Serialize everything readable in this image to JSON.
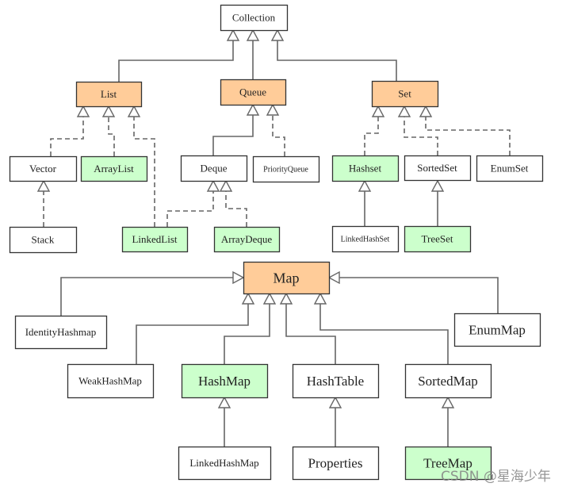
{
  "colors": {
    "interface": "#FFCC99",
    "implementation": "#CCFFCC",
    "plain": "#FFFFFF",
    "line": "#666666",
    "border": "#333333"
  },
  "nodes": {
    "collection": {
      "label": "Collection",
      "kind": "plain"
    },
    "list": {
      "label": "List",
      "kind": "interface"
    },
    "queue": {
      "label": "Queue",
      "kind": "interface"
    },
    "set": {
      "label": "Set",
      "kind": "interface"
    },
    "vector": {
      "label": "Vector",
      "kind": "plain"
    },
    "arraylist": {
      "label": "ArrayList",
      "kind": "implementation"
    },
    "deque": {
      "label": "Deque",
      "kind": "plain"
    },
    "priorityqueue": {
      "label": "PriorityQueue",
      "kind": "plain"
    },
    "hashset": {
      "label": "Hashset",
      "kind": "implementation"
    },
    "sortedset": {
      "label": "SortedSet",
      "kind": "plain"
    },
    "enumset": {
      "label": "EnumSet",
      "kind": "plain"
    },
    "stack": {
      "label": "Stack",
      "kind": "plain"
    },
    "linkedlist": {
      "label": "LinkedList",
      "kind": "implementation"
    },
    "arraydeque": {
      "label": "ArrayDeque",
      "kind": "implementation"
    },
    "linkedhashset": {
      "label": "LinkedHashSet",
      "kind": "plain"
    },
    "treeset": {
      "label": "TreeSet",
      "kind": "implementation"
    },
    "map": {
      "label": "Map",
      "kind": "interface"
    },
    "identityhashmap": {
      "label": "IdentityHashmap",
      "kind": "plain"
    },
    "enummap": {
      "label": "EnumMap",
      "kind": "plain"
    },
    "weakhashmap": {
      "label": "WeakHashMap",
      "kind": "plain"
    },
    "hashmap": {
      "label": "HashMap",
      "kind": "implementation"
    },
    "hashtable": {
      "label": "HashTable",
      "kind": "plain"
    },
    "sortedmap": {
      "label": "SortedMap",
      "kind": "plain"
    },
    "linkedhashmap": {
      "label": "LinkedHashMap",
      "kind": "plain"
    },
    "properties": {
      "label": "Properties",
      "kind": "plain"
    },
    "treemap": {
      "label": "TreeMap",
      "kind": "implementation"
    }
  },
  "edges": [
    {
      "from": "list",
      "to": "collection",
      "style": "solid"
    },
    {
      "from": "queue",
      "to": "collection",
      "style": "solid"
    },
    {
      "from": "set",
      "to": "collection",
      "style": "solid"
    },
    {
      "from": "vector",
      "to": "list",
      "style": "dashed"
    },
    {
      "from": "arraylist",
      "to": "list",
      "style": "dashed"
    },
    {
      "from": "linkedlist",
      "to": "list",
      "style": "dashed"
    },
    {
      "from": "stack",
      "to": "vector",
      "style": "dashed"
    },
    {
      "from": "deque",
      "to": "queue",
      "style": "solid"
    },
    {
      "from": "priorityqueue",
      "to": "queue",
      "style": "dashed"
    },
    {
      "from": "linkedlist",
      "to": "deque",
      "style": "dashed"
    },
    {
      "from": "arraydeque",
      "to": "deque",
      "style": "dashed"
    },
    {
      "from": "hashset",
      "to": "set",
      "style": "dashed"
    },
    {
      "from": "sortedset",
      "to": "set",
      "style": "dashed"
    },
    {
      "from": "enumset",
      "to": "set",
      "style": "dashed"
    },
    {
      "from": "linkedhashset",
      "to": "hashset",
      "style": "solid"
    },
    {
      "from": "treeset",
      "to": "sortedset",
      "style": "solid"
    },
    {
      "from": "identityhashmap",
      "to": "map",
      "style": "solid"
    },
    {
      "from": "enummap",
      "to": "map",
      "style": "solid"
    },
    {
      "from": "weakhashmap",
      "to": "map",
      "style": "solid"
    },
    {
      "from": "hashmap",
      "to": "map",
      "style": "solid"
    },
    {
      "from": "hashtable",
      "to": "map",
      "style": "solid"
    },
    {
      "from": "sortedmap",
      "to": "map",
      "style": "solid"
    },
    {
      "from": "linkedhashmap",
      "to": "hashmap",
      "style": "solid"
    },
    {
      "from": "properties",
      "to": "hashtable",
      "style": "solid"
    },
    {
      "from": "treemap",
      "to": "sortedmap",
      "style": "solid"
    }
  ],
  "watermark": "CSDN @星海少年"
}
